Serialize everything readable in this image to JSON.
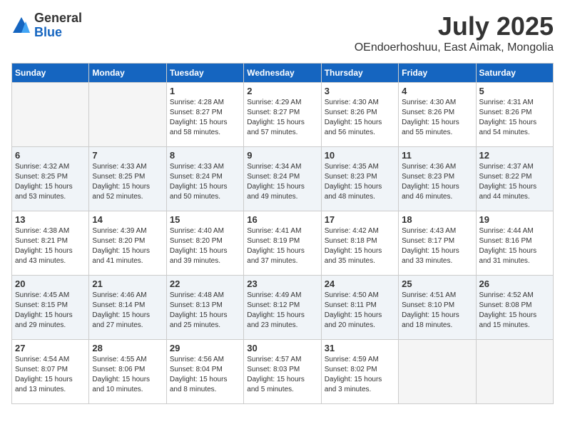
{
  "header": {
    "logo_general": "General",
    "logo_blue": "Blue",
    "month_title": "July 2025",
    "location": "OEndoerhoshuu, East Aimak, Mongolia"
  },
  "weekdays": [
    "Sunday",
    "Monday",
    "Tuesday",
    "Wednesday",
    "Thursday",
    "Friday",
    "Saturday"
  ],
  "weeks": [
    [
      {
        "day": "",
        "info": ""
      },
      {
        "day": "",
        "info": ""
      },
      {
        "day": "1",
        "info": "Sunrise: 4:28 AM\nSunset: 8:27 PM\nDaylight: 15 hours\nand 58 minutes."
      },
      {
        "day": "2",
        "info": "Sunrise: 4:29 AM\nSunset: 8:27 PM\nDaylight: 15 hours\nand 57 minutes."
      },
      {
        "day": "3",
        "info": "Sunrise: 4:30 AM\nSunset: 8:26 PM\nDaylight: 15 hours\nand 56 minutes."
      },
      {
        "day": "4",
        "info": "Sunrise: 4:30 AM\nSunset: 8:26 PM\nDaylight: 15 hours\nand 55 minutes."
      },
      {
        "day": "5",
        "info": "Sunrise: 4:31 AM\nSunset: 8:26 PM\nDaylight: 15 hours\nand 54 minutes."
      }
    ],
    [
      {
        "day": "6",
        "info": "Sunrise: 4:32 AM\nSunset: 8:25 PM\nDaylight: 15 hours\nand 53 minutes."
      },
      {
        "day": "7",
        "info": "Sunrise: 4:33 AM\nSunset: 8:25 PM\nDaylight: 15 hours\nand 52 minutes."
      },
      {
        "day": "8",
        "info": "Sunrise: 4:33 AM\nSunset: 8:24 PM\nDaylight: 15 hours\nand 50 minutes."
      },
      {
        "day": "9",
        "info": "Sunrise: 4:34 AM\nSunset: 8:24 PM\nDaylight: 15 hours\nand 49 minutes."
      },
      {
        "day": "10",
        "info": "Sunrise: 4:35 AM\nSunset: 8:23 PM\nDaylight: 15 hours\nand 48 minutes."
      },
      {
        "day": "11",
        "info": "Sunrise: 4:36 AM\nSunset: 8:23 PM\nDaylight: 15 hours\nand 46 minutes."
      },
      {
        "day": "12",
        "info": "Sunrise: 4:37 AM\nSunset: 8:22 PM\nDaylight: 15 hours\nand 44 minutes."
      }
    ],
    [
      {
        "day": "13",
        "info": "Sunrise: 4:38 AM\nSunset: 8:21 PM\nDaylight: 15 hours\nand 43 minutes."
      },
      {
        "day": "14",
        "info": "Sunrise: 4:39 AM\nSunset: 8:20 PM\nDaylight: 15 hours\nand 41 minutes."
      },
      {
        "day": "15",
        "info": "Sunrise: 4:40 AM\nSunset: 8:20 PM\nDaylight: 15 hours\nand 39 minutes."
      },
      {
        "day": "16",
        "info": "Sunrise: 4:41 AM\nSunset: 8:19 PM\nDaylight: 15 hours\nand 37 minutes."
      },
      {
        "day": "17",
        "info": "Sunrise: 4:42 AM\nSunset: 8:18 PM\nDaylight: 15 hours\nand 35 minutes."
      },
      {
        "day": "18",
        "info": "Sunrise: 4:43 AM\nSunset: 8:17 PM\nDaylight: 15 hours\nand 33 minutes."
      },
      {
        "day": "19",
        "info": "Sunrise: 4:44 AM\nSunset: 8:16 PM\nDaylight: 15 hours\nand 31 minutes."
      }
    ],
    [
      {
        "day": "20",
        "info": "Sunrise: 4:45 AM\nSunset: 8:15 PM\nDaylight: 15 hours\nand 29 minutes."
      },
      {
        "day": "21",
        "info": "Sunrise: 4:46 AM\nSunset: 8:14 PM\nDaylight: 15 hours\nand 27 minutes."
      },
      {
        "day": "22",
        "info": "Sunrise: 4:48 AM\nSunset: 8:13 PM\nDaylight: 15 hours\nand 25 minutes."
      },
      {
        "day": "23",
        "info": "Sunrise: 4:49 AM\nSunset: 8:12 PM\nDaylight: 15 hours\nand 23 minutes."
      },
      {
        "day": "24",
        "info": "Sunrise: 4:50 AM\nSunset: 8:11 PM\nDaylight: 15 hours\nand 20 minutes."
      },
      {
        "day": "25",
        "info": "Sunrise: 4:51 AM\nSunset: 8:10 PM\nDaylight: 15 hours\nand 18 minutes."
      },
      {
        "day": "26",
        "info": "Sunrise: 4:52 AM\nSunset: 8:08 PM\nDaylight: 15 hours\nand 15 minutes."
      }
    ],
    [
      {
        "day": "27",
        "info": "Sunrise: 4:54 AM\nSunset: 8:07 PM\nDaylight: 15 hours\nand 13 minutes."
      },
      {
        "day": "28",
        "info": "Sunrise: 4:55 AM\nSunset: 8:06 PM\nDaylight: 15 hours\nand 10 minutes."
      },
      {
        "day": "29",
        "info": "Sunrise: 4:56 AM\nSunset: 8:04 PM\nDaylight: 15 hours\nand 8 minutes."
      },
      {
        "day": "30",
        "info": "Sunrise: 4:57 AM\nSunset: 8:03 PM\nDaylight: 15 hours\nand 5 minutes."
      },
      {
        "day": "31",
        "info": "Sunrise: 4:59 AM\nSunset: 8:02 PM\nDaylight: 15 hours\nand 3 minutes."
      },
      {
        "day": "",
        "info": ""
      },
      {
        "day": "",
        "info": ""
      }
    ]
  ]
}
